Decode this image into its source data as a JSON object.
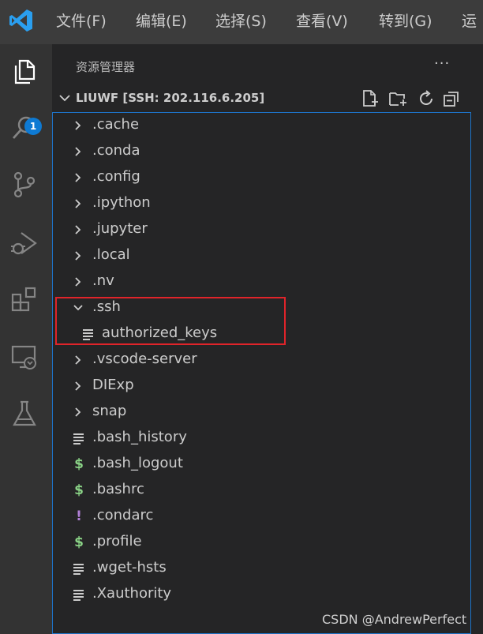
{
  "menubar": {
    "logo": "vscode-logo",
    "items": [
      "文件(F)",
      "编辑(E)",
      "选择(S)",
      "查看(V)",
      "转到(G)",
      "运"
    ]
  },
  "activitybar": {
    "icons": [
      "files-icon",
      "search-icon",
      "source-control-icon",
      "run-debug-icon",
      "extensions-icon",
      "remote-explorer-icon",
      "testing-icon"
    ],
    "badge": "1"
  },
  "explorer": {
    "title": "资源管理器",
    "more": "···",
    "section": {
      "title": "LIUWF [SSH: 202.116.6.205]",
      "actions": [
        "new-file-icon",
        "new-folder-icon",
        "refresh-icon",
        "collapse-all-icon"
      ]
    },
    "tree": [
      {
        "label": ".cache",
        "kind": "folder",
        "expanded": false
      },
      {
        "label": ".conda",
        "kind": "folder",
        "expanded": false
      },
      {
        "label": ".config",
        "kind": "folder",
        "expanded": false
      },
      {
        "label": ".ipython",
        "kind": "folder",
        "expanded": false
      },
      {
        "label": ".jupyter",
        "kind": "folder",
        "expanded": false
      },
      {
        "label": ".local",
        "kind": "folder",
        "expanded": false
      },
      {
        "label": ".nv",
        "kind": "folder",
        "expanded": false
      },
      {
        "label": ".ssh",
        "kind": "folder",
        "expanded": true
      },
      {
        "label": "authorized_keys",
        "kind": "file",
        "icon": "lines-file-icon",
        "nested": true
      },
      {
        "label": ".vscode-server",
        "kind": "folder",
        "expanded": false
      },
      {
        "label": "DIExp",
        "kind": "folder",
        "expanded": false
      },
      {
        "label": "snap",
        "kind": "folder",
        "expanded": false
      },
      {
        "label": ".bash_history",
        "kind": "file",
        "icon": "lines-file-icon"
      },
      {
        "label": ".bash_logout",
        "kind": "file",
        "icon": "shell-dollar-icon"
      },
      {
        "label": ".bashrc",
        "kind": "file",
        "icon": "shell-dollar-icon"
      },
      {
        "label": ".condarc",
        "kind": "file",
        "icon": "exclamation-file-icon"
      },
      {
        "label": ".profile",
        "kind": "file",
        "icon": "shell-dollar-icon"
      },
      {
        "label": ".wget-hsts",
        "kind": "file",
        "icon": "lines-file-icon"
      },
      {
        "label": ".Xauthority",
        "kind": "file",
        "icon": "lines-file-icon"
      }
    ]
  },
  "colors": {
    "highlight": "#e0242a",
    "focus_border": "#1e73c8",
    "shell_icon": "#89d185",
    "exclamation_icon": "#b180d7",
    "badge": "#0e7ad3"
  },
  "watermark": "CSDN @AndrewPerfect"
}
